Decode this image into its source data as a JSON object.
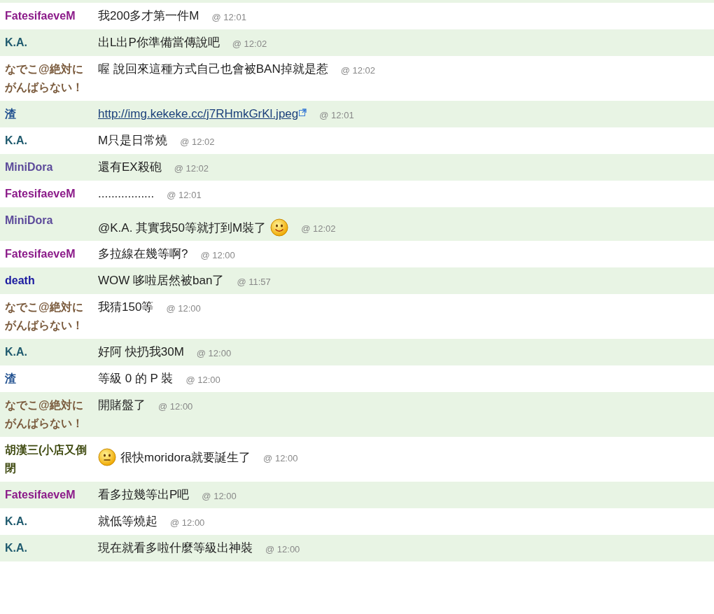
{
  "messages": [
    {
      "user": "FatesifaeveM",
      "color": "#8b1a89",
      "parts": [
        {
          "kind": "text",
          "text": "我200多才第一件M"
        }
      ],
      "time": "@ 12:01"
    },
    {
      "user": "K.A.",
      "color": "#1f5a6e",
      "parts": [
        {
          "kind": "text",
          "text": "出L出P你準備當傳說吧"
        }
      ],
      "time": "@ 12:02"
    },
    {
      "user": "なでこ@絶対にがんばらない！",
      "color": "#7a5a3c",
      "parts": [
        {
          "kind": "text",
          "text": "喔 說回來這種方式自己也會被BAN掉就是惹"
        }
      ],
      "time": "@ 12:02"
    },
    {
      "user": "渣",
      "color": "#1f4f8f",
      "parts": [
        {
          "kind": "link",
          "text": "http://img.kekeke.cc/j7RHmkGrKl.jpeg"
        }
      ],
      "time": "@ 12:01"
    },
    {
      "user": "K.A.",
      "color": "#1f5a6e",
      "parts": [
        {
          "kind": "text",
          "text": "M只是日常燒"
        }
      ],
      "time": "@ 12:02"
    },
    {
      "user": "MiniDora",
      "color": "#5c4a9a",
      "parts": [
        {
          "kind": "text",
          "text": "還有EX殺砲"
        }
      ],
      "time": "@ 12:02"
    },
    {
      "user": "FatesifaeveM",
      "color": "#8b1a89",
      "parts": [
        {
          "kind": "text",
          "text": "................."
        }
      ],
      "time": "@ 12:01"
    },
    {
      "user": "MiniDora",
      "color": "#5c4a9a",
      "parts": [
        {
          "kind": "text",
          "text": "@K.A. 其實我50等就打到M裝了"
        },
        {
          "kind": "smile"
        }
      ],
      "time": "@ 12:02"
    },
    {
      "user": "FatesifaeveM",
      "color": "#8b1a89",
      "parts": [
        {
          "kind": "text",
          "text": "多拉線在幾等啊?"
        }
      ],
      "time": "@ 12:00"
    },
    {
      "user": "death",
      "color": "#1a1aa0",
      "parts": [
        {
          "kind": "text",
          "text": "WOW 哆啦居然被ban了"
        }
      ],
      "time": "@ 11:57"
    },
    {
      "user": "なでこ@絶対にがんばらない！",
      "color": "#7a5a3c",
      "parts": [
        {
          "kind": "text",
          "text": "我猜150等"
        }
      ],
      "time": "@ 12:00"
    },
    {
      "user": "K.A.",
      "color": "#1f5a6e",
      "parts": [
        {
          "kind": "text",
          "text": "好阿 快扔我30M"
        }
      ],
      "time": "@ 12:00"
    },
    {
      "user": "渣",
      "color": "#1f4f8f",
      "parts": [
        {
          "kind": "text",
          "text": "等級 0 的 P 裝"
        }
      ],
      "time": "@ 12:00"
    },
    {
      "user": "なでこ@絶対にがんばらない！",
      "color": "#7a5a3c",
      "parts": [
        {
          "kind": "text",
          "text": "開賭盤了"
        }
      ],
      "time": "@ 12:00"
    },
    {
      "user": "胡漢三(小店又倒閉",
      "color": "#3f4a10",
      "parts": [
        {
          "kind": "neutral"
        },
        {
          "kind": "text",
          "text": "很快moridora就要誕生了"
        }
      ],
      "time": "@ 12:00"
    },
    {
      "user": "FatesifaeveM",
      "color": "#8b1a89",
      "parts": [
        {
          "kind": "text",
          "text": "看多拉幾等出P吧"
        }
      ],
      "time": "@ 12:00"
    },
    {
      "user": "K.A.",
      "color": "#1f5a6e",
      "parts": [
        {
          "kind": "text",
          "text": "就低等燒起"
        }
      ],
      "time": "@ 12:00"
    },
    {
      "user": "K.A.",
      "color": "#1f5a6e",
      "parts": [
        {
          "kind": "text",
          "text": "現在就看多啦什麼等級出神裝"
        }
      ],
      "time": "@ 12:00"
    }
  ]
}
